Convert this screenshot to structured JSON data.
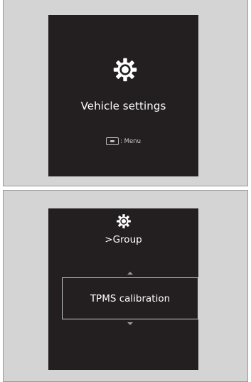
{
  "screens": {
    "vehicle_settings": {
      "icon": "gear-icon",
      "title": "Vehicle settings",
      "menu_icon": "menu-button-icon",
      "menu_hint": ": Menu"
    },
    "group_screen": {
      "icon": "gear-icon",
      "group_label": ">Group",
      "selected_item": "TPMS calibration"
    }
  },
  "colors": {
    "screen_background": "#231f20",
    "panel_background": "#d4d4d4",
    "text": "#ffffff"
  }
}
